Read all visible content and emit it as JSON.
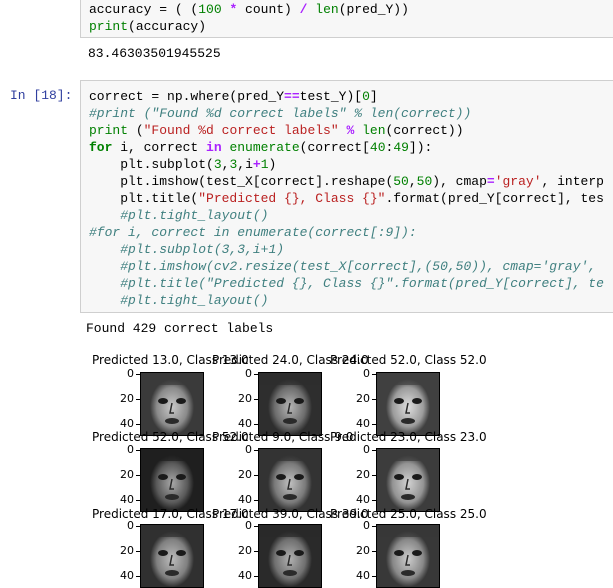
{
  "prev_cell": {
    "code_line1": "accuracy = ( (100 * count) / len(pred_Y))",
    "code_line2": "print(accuracy)",
    "output": "83.46303501945525"
  },
  "cell18": {
    "prompt": "In [18]:",
    "lines": [
      "correct = np.where(pred_Y==test_Y)[0]",
      "#print (\"Found %d correct labels\" % len(correct))",
      "print (\"Found %d correct labels\" % len(correct))",
      "for i, correct in enumerate(correct[40:49]):",
      "    plt.subplot(3,3,i+1)",
      "    plt.imshow(test_X[correct].reshape(50,50), cmap='gray', interp",
      "    plt.title(\"Predicted {}, Class {}\".format(pred_Y[correct], tes",
      "    #plt.tight_layout()",
      "#for i, correct in enumerate(correct[:9]):",
      "    #plt.subplot(3,3,i+1)",
      "    #plt.imshow(cv2.resize(test_X[correct],(50,50)), cmap='gray',",
      "    #plt.title(\"Predicted {}, Class {}\".format(pred_Y[correct], te",
      "    #plt.tight_layout()"
    ],
    "output": "Found 429 correct labels"
  },
  "plots": {
    "titles": [
      "Predicted 13.0, Class 13.0",
      "Predicted 24.0, Class 24.0",
      "Predicted 52.0, Class 52.0",
      "Predicted 52.0, Class 52.0",
      "Predicted 9.0, Class 9.0",
      "Predicted 23.0, Class 23.0",
      "Predicted 17.0, Class 17.0",
      "Predicted 39.0, Class 39.0",
      "Predicted 25.0, Class 25.0"
    ],
    "yticks": [
      "0",
      "20",
      "40"
    ],
    "colors": {
      "prompt": "#303f9f",
      "keyword": "#008000",
      "string": "#ba2121",
      "comment": "#408080"
    }
  }
}
